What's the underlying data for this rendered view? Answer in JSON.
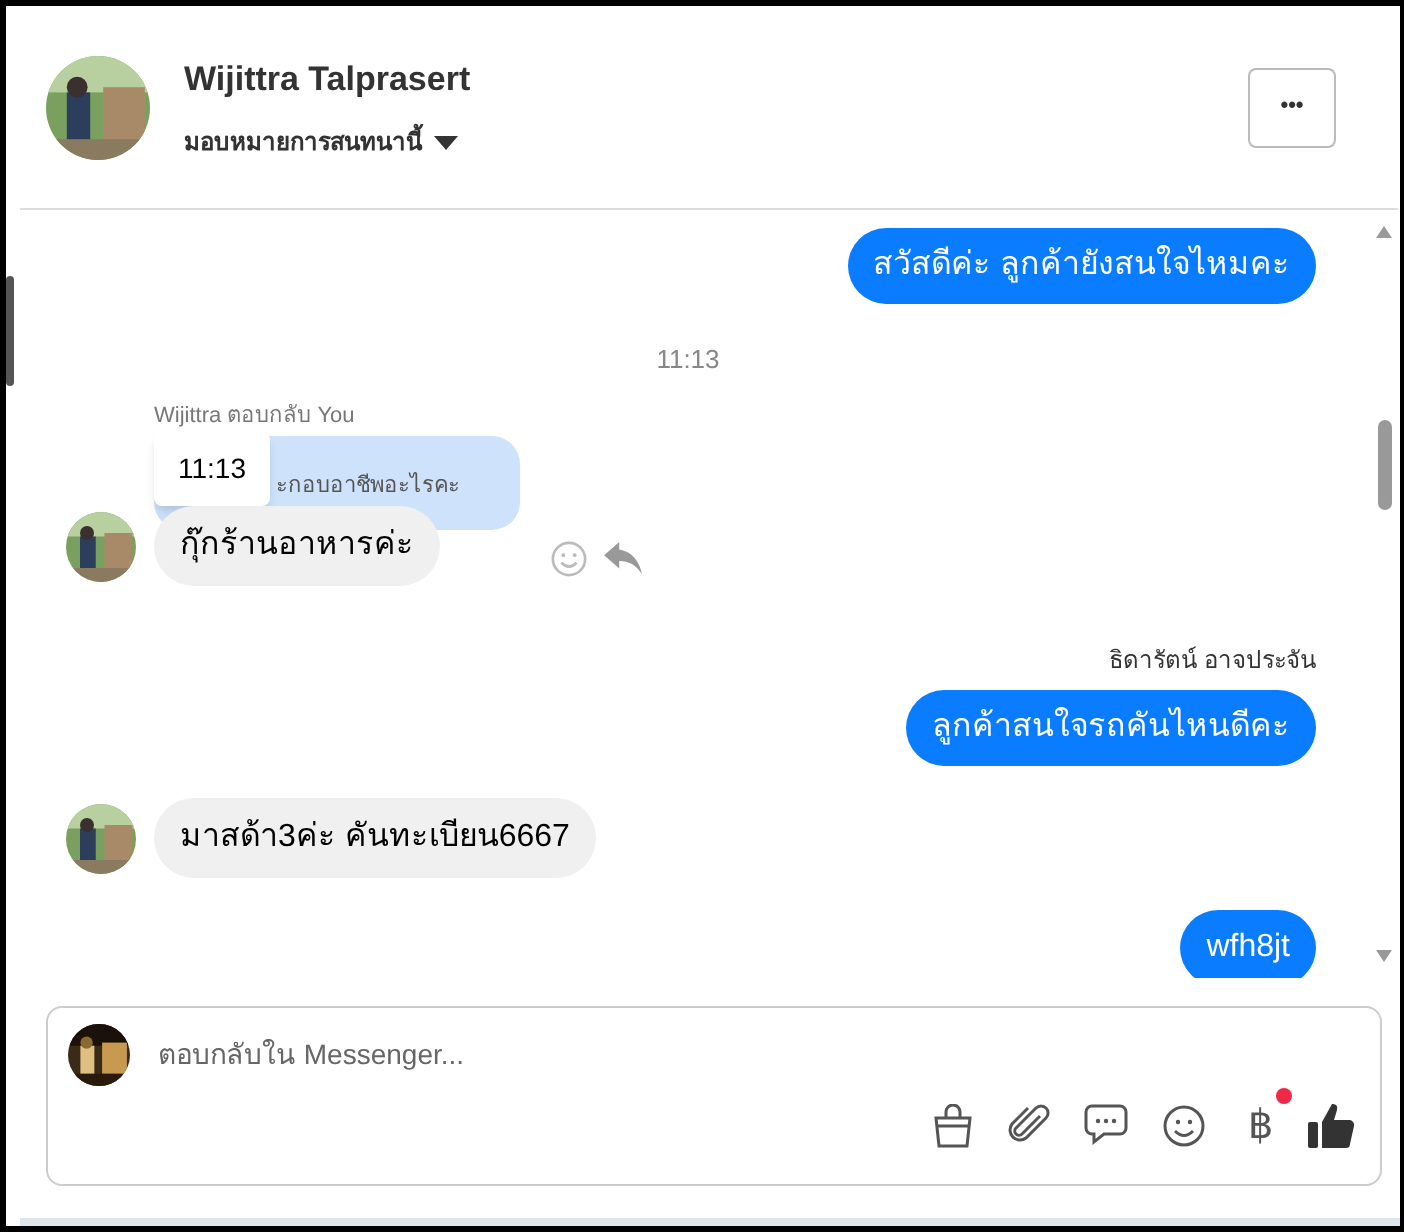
{
  "header": {
    "name": "Wijittra Talprasert",
    "assign_label": "มอบหมายการสนทนานี้",
    "menu_button": "•••"
  },
  "messages": [
    {
      "kind": "outgoing",
      "text": "สวัสดีค่ะ ลูกค้ายังสนใจไหมคะ"
    },
    {
      "kind": "timestamp",
      "text": "11:13"
    },
    {
      "kind": "incoming_reply",
      "reply_label": "Wijittra ตอบกลับ You",
      "quote": "ะกอบอาชีพอะไรคะ",
      "tooltip": "11:13",
      "text": "กุ๊กร้านอาหารค่ะ"
    },
    {
      "kind": "sender",
      "text": "ธิดารัตน์ อาจประจัน"
    },
    {
      "kind": "outgoing",
      "text": "ลูกค้าสนใจรถคันไหนดีคะ"
    },
    {
      "kind": "incoming",
      "text": "มาสด้า3ค่ะ คันทะเบียน6667"
    },
    {
      "kind": "outgoing",
      "text": "wfh8jt"
    }
  ],
  "composer": {
    "placeholder": "ตอบกลับใน Messenger...",
    "baht_symbol": "฿",
    "payment_notice": true
  }
}
